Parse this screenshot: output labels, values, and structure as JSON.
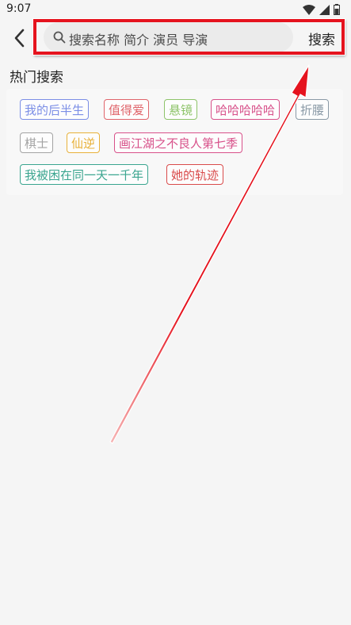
{
  "status_bar": {
    "time": "9:07",
    "icons": [
      "wifi-icon",
      "signal-icon",
      "battery-icon"
    ]
  },
  "header": {
    "search_placeholder": "搜索名称 简介 演员 导演",
    "search_button": "搜索"
  },
  "hot_search": {
    "title": "热门搜索",
    "tags": [
      {
        "label": "我的后半生",
        "color": "#7b8ee6"
      },
      {
        "label": "值得爱",
        "color": "#e0656b"
      },
      {
        "label": "悬镜",
        "color": "#8ec46a"
      },
      {
        "label": "哈哈哈哈哈",
        "color": "#d8518a"
      },
      {
        "label": "折腰",
        "color": "#8a9aa6"
      },
      {
        "label": "棋士",
        "color": "#a3a3a3"
      },
      {
        "label": "仙逆",
        "color": "#e8b13a"
      },
      {
        "label": "画江湖之不良人第七季",
        "color": "#d8518a"
      },
      {
        "label": "我被困在同一天一千年",
        "color": "#3aa58f"
      },
      {
        "label": "她的轨迹",
        "color": "#d94b4b"
      }
    ]
  },
  "colors": {
    "highlight": "#e5131e",
    "background": "#f5f5f5"
  }
}
